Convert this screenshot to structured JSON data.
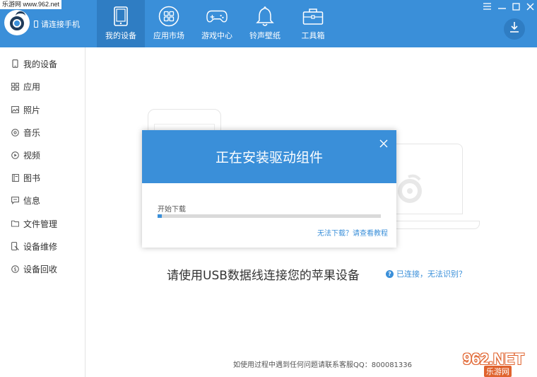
{
  "watermark": {
    "top_left": "乐游网 www.962.net",
    "bottom_right_brand": "962.NET",
    "bottom_right_sub": "乐游网"
  },
  "header": {
    "connect_label": "请连接手机",
    "tabs": [
      {
        "label": "我的设备",
        "icon": "tablet-icon",
        "active": true
      },
      {
        "label": "应用市场",
        "icon": "apps-grid-icon",
        "active": false
      },
      {
        "label": "游戏中心",
        "icon": "gamepad-icon",
        "active": false
      },
      {
        "label": "铃声壁纸",
        "icon": "bell-icon",
        "active": false
      },
      {
        "label": "工具箱",
        "icon": "toolbox-icon",
        "active": false
      }
    ],
    "window_controls": [
      "menu-icon",
      "minimize-icon",
      "restore-icon",
      "close-icon"
    ]
  },
  "sidebar": {
    "items": [
      {
        "label": "我的设备",
        "icon": "phone-icon"
      },
      {
        "label": "应用",
        "icon": "apps-icon"
      },
      {
        "label": "照片",
        "icon": "photo-icon"
      },
      {
        "label": "音乐",
        "icon": "music-icon"
      },
      {
        "label": "视频",
        "icon": "video-icon"
      },
      {
        "label": "图书",
        "icon": "book-icon"
      },
      {
        "label": "信息",
        "icon": "message-icon"
      },
      {
        "label": "文件管理",
        "icon": "folder-icon"
      },
      {
        "label": "设备维修",
        "icon": "repair-icon"
      },
      {
        "label": "设备回收",
        "icon": "recycle-icon"
      }
    ]
  },
  "main": {
    "hint": "请使用USB数据线连接您的苹果设备",
    "help_link": "已连接，无法识别？",
    "footer": "如使用过程中遇到任何问题请联系客服QQ：800081336"
  },
  "modal": {
    "title": "正在安装驱动组件",
    "status": "开始下载",
    "progress": 0.02,
    "help_link": "无法下载？请查看教程"
  },
  "colors": {
    "accent": "#3a8fd9",
    "accent_dark": "#2f7dc3",
    "watermark_orange": "#e0632e"
  }
}
